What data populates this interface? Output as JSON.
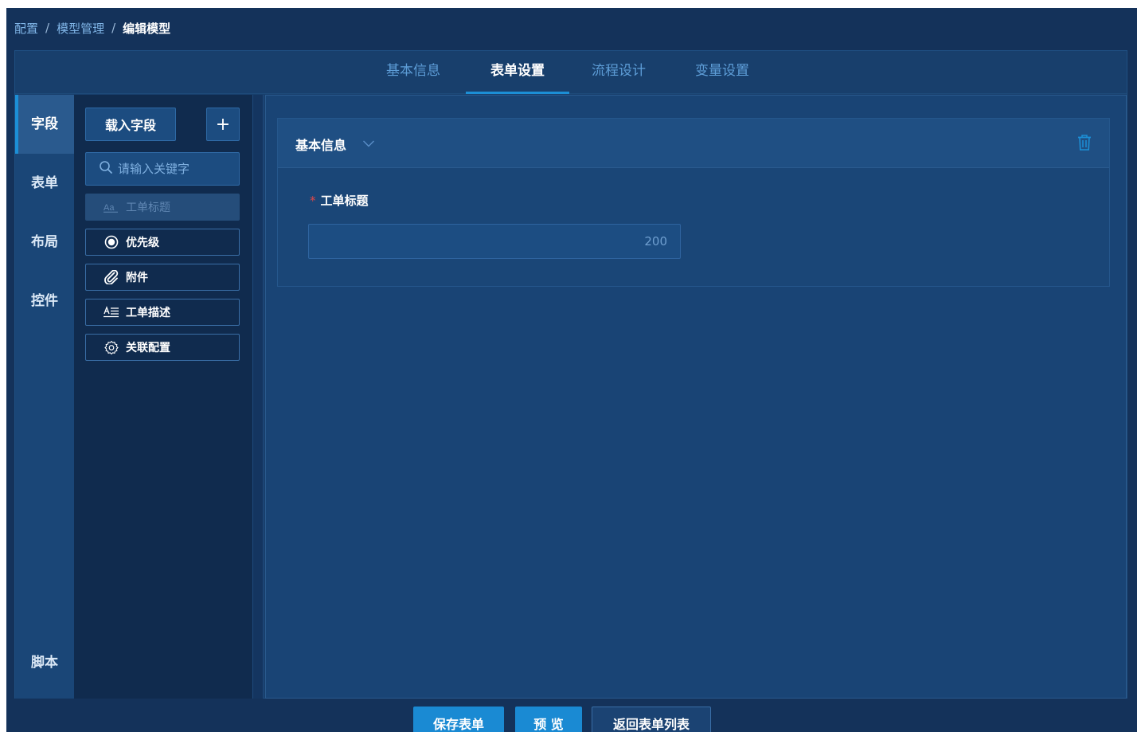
{
  "breadcrumb": {
    "items": [
      "配置",
      "模型管理"
    ],
    "separator": "/",
    "current": "编辑模型"
  },
  "tabs": [
    {
      "label": "基本信息",
      "active": false
    },
    {
      "label": "表单设置",
      "active": true
    },
    {
      "label": "流程设计",
      "active": false
    },
    {
      "label": "变量设置",
      "active": false
    }
  ],
  "leftnav": {
    "items": [
      {
        "label": "字段",
        "active": true
      },
      {
        "label": "表单",
        "active": false
      },
      {
        "label": "布局",
        "active": false
      },
      {
        "label": "控件",
        "active": false
      },
      {
        "label": "脚本",
        "active": false
      }
    ]
  },
  "fieldpanel": {
    "load_label": "载入字段",
    "add_label": "+",
    "search_placeholder": "请输入关键字",
    "items": [
      {
        "label": "工单标题",
        "icon": "text-aa-icon",
        "disabled": true
      },
      {
        "label": "优先级",
        "icon": "radio-icon",
        "disabled": false
      },
      {
        "label": "附件",
        "icon": "paperclip-icon",
        "disabled": false
      },
      {
        "label": "工单描述",
        "icon": "text-area-icon",
        "disabled": false
      },
      {
        "label": "关联配置",
        "icon": "gear-icon",
        "disabled": false
      }
    ]
  },
  "section": {
    "title": "基本信息",
    "field_required_mark": "*",
    "field_label": "工单标题",
    "field_counter": "200"
  },
  "actions": {
    "save_label": "保存表单",
    "preview_label": "预 览",
    "back_label": "返回表单列表"
  },
  "colors": {
    "accent": "#1a8ad3",
    "background": "#14325a",
    "required": "#e04848"
  }
}
